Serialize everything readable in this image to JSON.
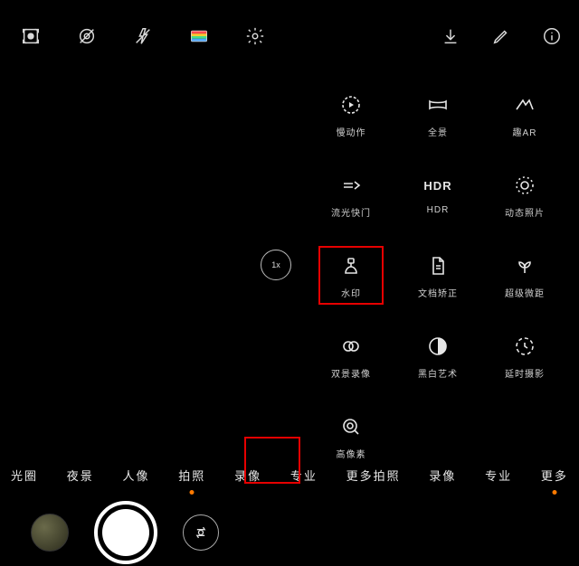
{
  "zoom": {
    "label": "1x"
  },
  "features": [
    {
      "id": "slowmo",
      "label": "慢动作"
    },
    {
      "id": "panorama",
      "label": "全景"
    },
    {
      "id": "ar",
      "label": "趣AR"
    },
    {
      "id": "lightpaint",
      "label": "流光快门"
    },
    {
      "id": "hdr",
      "label": "HDR"
    },
    {
      "id": "livephoto",
      "label": "动态照片"
    },
    {
      "id": "watermark",
      "label": "水印",
      "highlight": true
    },
    {
      "id": "docscan",
      "label": "文档矫正"
    },
    {
      "id": "macro",
      "label": "超级微距"
    },
    {
      "id": "dualview",
      "label": "双景录像"
    },
    {
      "id": "bw",
      "label": "黑白艺术"
    },
    {
      "id": "timelapse",
      "label": "延时摄影"
    },
    {
      "id": "hires",
      "label": "高像素"
    }
  ],
  "modes": [
    {
      "id": "aperture",
      "label": "光圈"
    },
    {
      "id": "night",
      "label": "夜景"
    },
    {
      "id": "portrait",
      "label": "人像"
    },
    {
      "id": "photo",
      "label": "拍照",
      "active": true
    },
    {
      "id": "video",
      "label": "录像"
    },
    {
      "id": "pro",
      "label": "专业"
    },
    {
      "id": "more1",
      "label": "更多拍照"
    },
    {
      "id": "video2",
      "label": "录像"
    },
    {
      "id": "pro2",
      "label": "专业"
    },
    {
      "id": "more2",
      "label": "更多",
      "active": true
    }
  ]
}
